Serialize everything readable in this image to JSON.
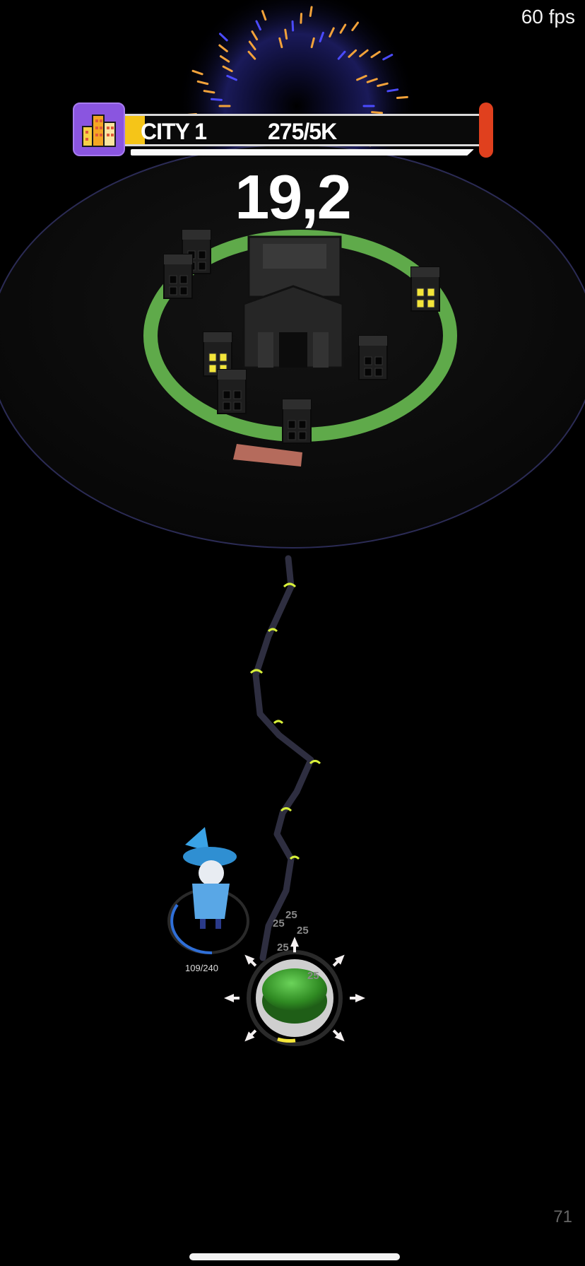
{
  "status": {
    "fps": "60 fps",
    "corner_number": "71"
  },
  "hud": {
    "city_label": "CITY 1",
    "progress_text": "275/5K",
    "progress_fraction": 0.055,
    "icon": "city-buildings-icon"
  },
  "score": "19,2",
  "player": {
    "hp_text": "109/240",
    "hp_fraction": 0.45
  },
  "button": {
    "damage_numbers": [
      "25",
      "25",
      "25",
      "25",
      "25"
    ]
  },
  "colors": {
    "ring": "#5faa4a",
    "button": "#3f9b2e",
    "accent": "#f5c518",
    "bar_end": "#e0401e",
    "city_icon_bg": "#8a55e0"
  }
}
